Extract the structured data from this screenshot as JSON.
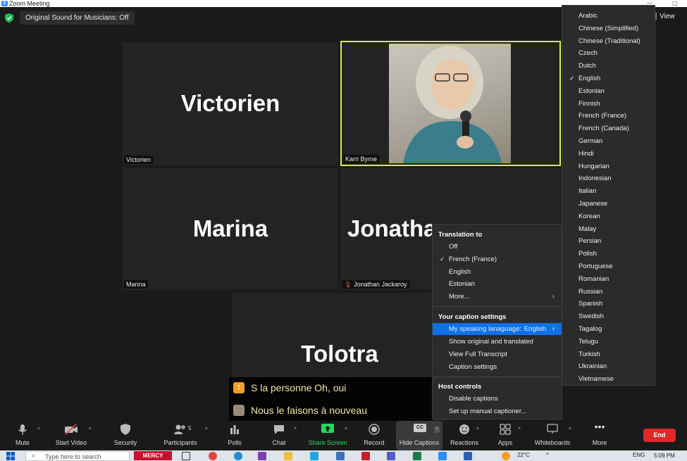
{
  "window": {
    "title": "Zoom Meeting",
    "minimize": "—",
    "restore": "▢"
  },
  "topbar": {
    "original_sound": "Original Sound for Musicians: Off",
    "view_label": "View"
  },
  "tiles": [
    {
      "name": "Victorien",
      "label": "Victorien"
    },
    {
      "name": "Karri Byrne",
      "label": "Karri Byrne"
    },
    {
      "name": "Marina",
      "label": "Marina"
    },
    {
      "name": "Jonatha",
      "label": "Jonathan Jackaroy"
    },
    {
      "name": "Tolotra",
      "label": ""
    }
  ],
  "captions": [
    {
      "initial": "T",
      "text": "S la personne Oh, oui",
      "color": "#f0a020"
    },
    {
      "initial": "",
      "text": "Nous le faisons à nouveau",
      "color": "#9a8a7a"
    }
  ],
  "caption_menu": {
    "translation_header": "Translation to",
    "translation_items": [
      "Off",
      "French (France)",
      "English",
      "Estonian",
      "More..."
    ],
    "translation_selected": "French (France)",
    "settings_header": "Your caption settings",
    "speaking_language_label": "My speaking lanaguage:",
    "speaking_language_value": "English",
    "settings_items": [
      "Show original and translated",
      "View Full Transcript",
      "Caption settings"
    ],
    "host_header": "Host controls",
    "host_items": [
      "Disable captions",
      "Set up manual captioner..."
    ],
    "checkmark": "✓",
    "arrow": "›"
  },
  "languages": {
    "items": [
      "Arabic",
      "Chinese (Simplified)",
      "Chinese (Traditional)",
      "Czech",
      "Dutch",
      "English",
      "Estonian",
      "Finnish",
      "French (France)",
      "French (Canada)",
      "German",
      "Hindi",
      "Hungarian",
      "Indonesian",
      "Italian",
      "Japanese",
      "Korean",
      "Malay",
      "Persian",
      "Polish",
      "Portuguese",
      "Romanian",
      "Russian",
      "Spanish",
      "Swedish",
      "Tagalog",
      "Telugu",
      "Turkish",
      "Ukrainian",
      "Vietnamese"
    ],
    "selected": "English"
  },
  "toolbar": {
    "mute": "Mute",
    "start_video": "Start Video",
    "security": "Security",
    "participants": "Participants",
    "participants_count": "5",
    "polls": "Polls",
    "chat": "Chat",
    "share_screen": "Share Screen",
    "record": "Record",
    "hide_captions": "Hide Captions",
    "cc": "CC",
    "reactions": "Reactions",
    "apps": "Apps",
    "whiteboards": "Whiteboards",
    "more": "More",
    "end": "End",
    "caret": "^"
  },
  "taskbar": {
    "search_placeholder": "Type here to search",
    "mercy": "MERCY",
    "temperature": "22°C",
    "language": "ENG",
    "time": "5:09 PM"
  },
  "colors": {
    "active_speaker": "#d8ec4c",
    "highlight": "#0e71eb",
    "share_green": "#23d959",
    "end_red": "#e02828",
    "security_green": "#1fbf5a"
  }
}
